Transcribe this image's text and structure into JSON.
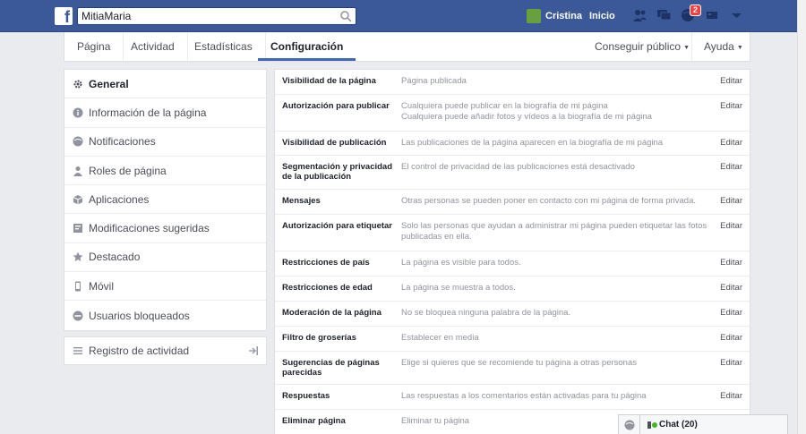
{
  "topbar": {
    "logo": "f",
    "search_value": "MitiaMaria",
    "user_name": "Cristina",
    "home_label": "Inicio",
    "notification_count": "2"
  },
  "page_nav": {
    "tabs": [
      "Página",
      "Actividad",
      "Estadísticas",
      "Configuración"
    ],
    "active_tab": "Configuración",
    "promote_label": "Conseguir público",
    "help_label": "Ayuda"
  },
  "sidebar": {
    "items": [
      {
        "label": "General",
        "icon": "gear-icon",
        "active": true
      },
      {
        "label": "Información de la página",
        "icon": "info-icon"
      },
      {
        "label": "Notificaciones",
        "icon": "globe-icon"
      },
      {
        "label": "Roles de página",
        "icon": "person-icon"
      },
      {
        "label": "Aplicaciones",
        "icon": "cube-icon"
      },
      {
        "label": "Modificaciones sugeridas",
        "icon": "suggestion-icon"
      },
      {
        "label": "Destacado",
        "icon": "star-icon"
      },
      {
        "label": "Móvil",
        "icon": "phone-icon"
      },
      {
        "label": "Usuarios bloqueados",
        "icon": "blocked-icon"
      }
    ],
    "activity_log": "Registro de actividad"
  },
  "settings": {
    "edit_label": "Editar",
    "rows": [
      {
        "label": "Visibilidad de la página",
        "value": "Página publicada"
      },
      {
        "label": "Autorización para publicar",
        "value": "Cualquiera puede publicar en la biografía de mi página\nCualquiera puede añadir fotos y vídeos a la biografía de mi página"
      },
      {
        "label": "Visibilidad de publicación",
        "value": "Las publicaciones de la página aparecen en la biografía de mi página"
      },
      {
        "label": "Segmentación y privacidad de la publicación",
        "value": "El control de privacidad de las publicaciones está desactivado"
      },
      {
        "label": "Mensajes",
        "value": "Otras personas se pueden poner en contacto con mi página de forma privada."
      },
      {
        "label": "Autorización para etiquetar",
        "value": "Solo las personas que ayudan a administrar mi página pueden etiquetar las fotos publicadas en ella."
      },
      {
        "label": "Restricciones de país",
        "value": "La página es visible para todos."
      },
      {
        "label": "Restricciones de edad",
        "value": "La página se muestra a todos."
      },
      {
        "label": "Moderación de la página",
        "value": "No se bloquea ninguna palabra de la página."
      },
      {
        "label": "Filtro de groserías",
        "value": "Establecer en media"
      },
      {
        "label": "Sugerencias de páginas parecidas",
        "value": "Elige si quieres que se recomiende tu página a otras personas"
      },
      {
        "label": "Respuestas",
        "value": "Las respuestas a los comentarios están activadas para tu página"
      },
      {
        "label": "Eliminar página",
        "value": "Eliminar tu página"
      }
    ]
  },
  "chat": {
    "label": "Chat (20)"
  },
  "colors": {
    "brand": "#3b5998",
    "background": "#e9ebee",
    "badge": "#fa3e3e"
  }
}
